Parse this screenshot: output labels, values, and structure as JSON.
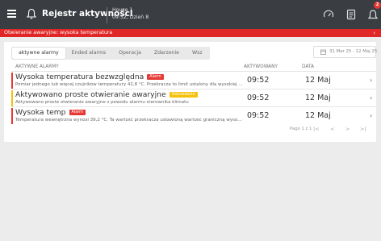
{
  "topbar": {
    "title": "Rejestr aktywności",
    "context_line1": "House 1",
    "context_line2": "09:52, Dzień 8",
    "notification_count": "2",
    "icons": [
      "menu-icon",
      "bell-icon",
      "gauge-icon",
      "report-icon",
      "alarm-bell-icon"
    ]
  },
  "alarm_banner": {
    "text": "Otwieranie awaryjne: wysoka temperatura"
  },
  "tabs": [
    {
      "label": "aktywne alarmy",
      "active": true
    },
    {
      "label": "Ended alarms",
      "active": false
    },
    {
      "label": "Operacja",
      "active": false
    },
    {
      "label": "Zdarzenie",
      "active": false
    },
    {
      "label": "Wsz",
      "active": false
    }
  ],
  "date_range": "31 Mar 25 - 12 Maj 25",
  "table": {
    "headers": [
      "AKTYWNE ALARMY",
      "AKTYWOWANY",
      "DATA"
    ],
    "rows": [
      {
        "title": "Wysoka temperatura bezwzględna",
        "tag": "Alarm",
        "tag_color": "#e53935",
        "stripe_color": "#e53935",
        "description": "Pomiar jednego lub więcej czujników temperatury 42,8 °C. Przekracza to limit ustalony dla wysokiej temperatury",
        "time": "09:52",
        "date": "12 Maj"
      },
      {
        "title": "Aktywowano proste otwieranie awaryjne",
        "tag": "Ostrzeżenie",
        "tag_color": "#f5c20b",
        "stripe_color": "#f5c20b",
        "description": "Aktywowano proste otwieranie awaryjne z powodu alarmu sterownika klimatu",
        "time": "09:52",
        "date": "12 Maj"
      },
      {
        "title": "Wysoka temp",
        "tag": "Alarm",
        "tag_color": "#e53935",
        "stripe_color": "#e53935",
        "description": "Temperatura wewnętrzna wynosi 39,2 °C. Ta wartość przekracza ustawioną wartość graniczną wysokiej temperatury",
        "time": "09:52",
        "date": "12 Maj"
      }
    ]
  },
  "pagination": {
    "text": "Page 1 z 1",
    "first": "|<",
    "prev": "<",
    "next": ">",
    "last": ">|"
  },
  "colors": {
    "topbar": "#3a3d42",
    "alarm": "#e02626",
    "warning": "#f5c20b",
    "background": "#ececec"
  }
}
